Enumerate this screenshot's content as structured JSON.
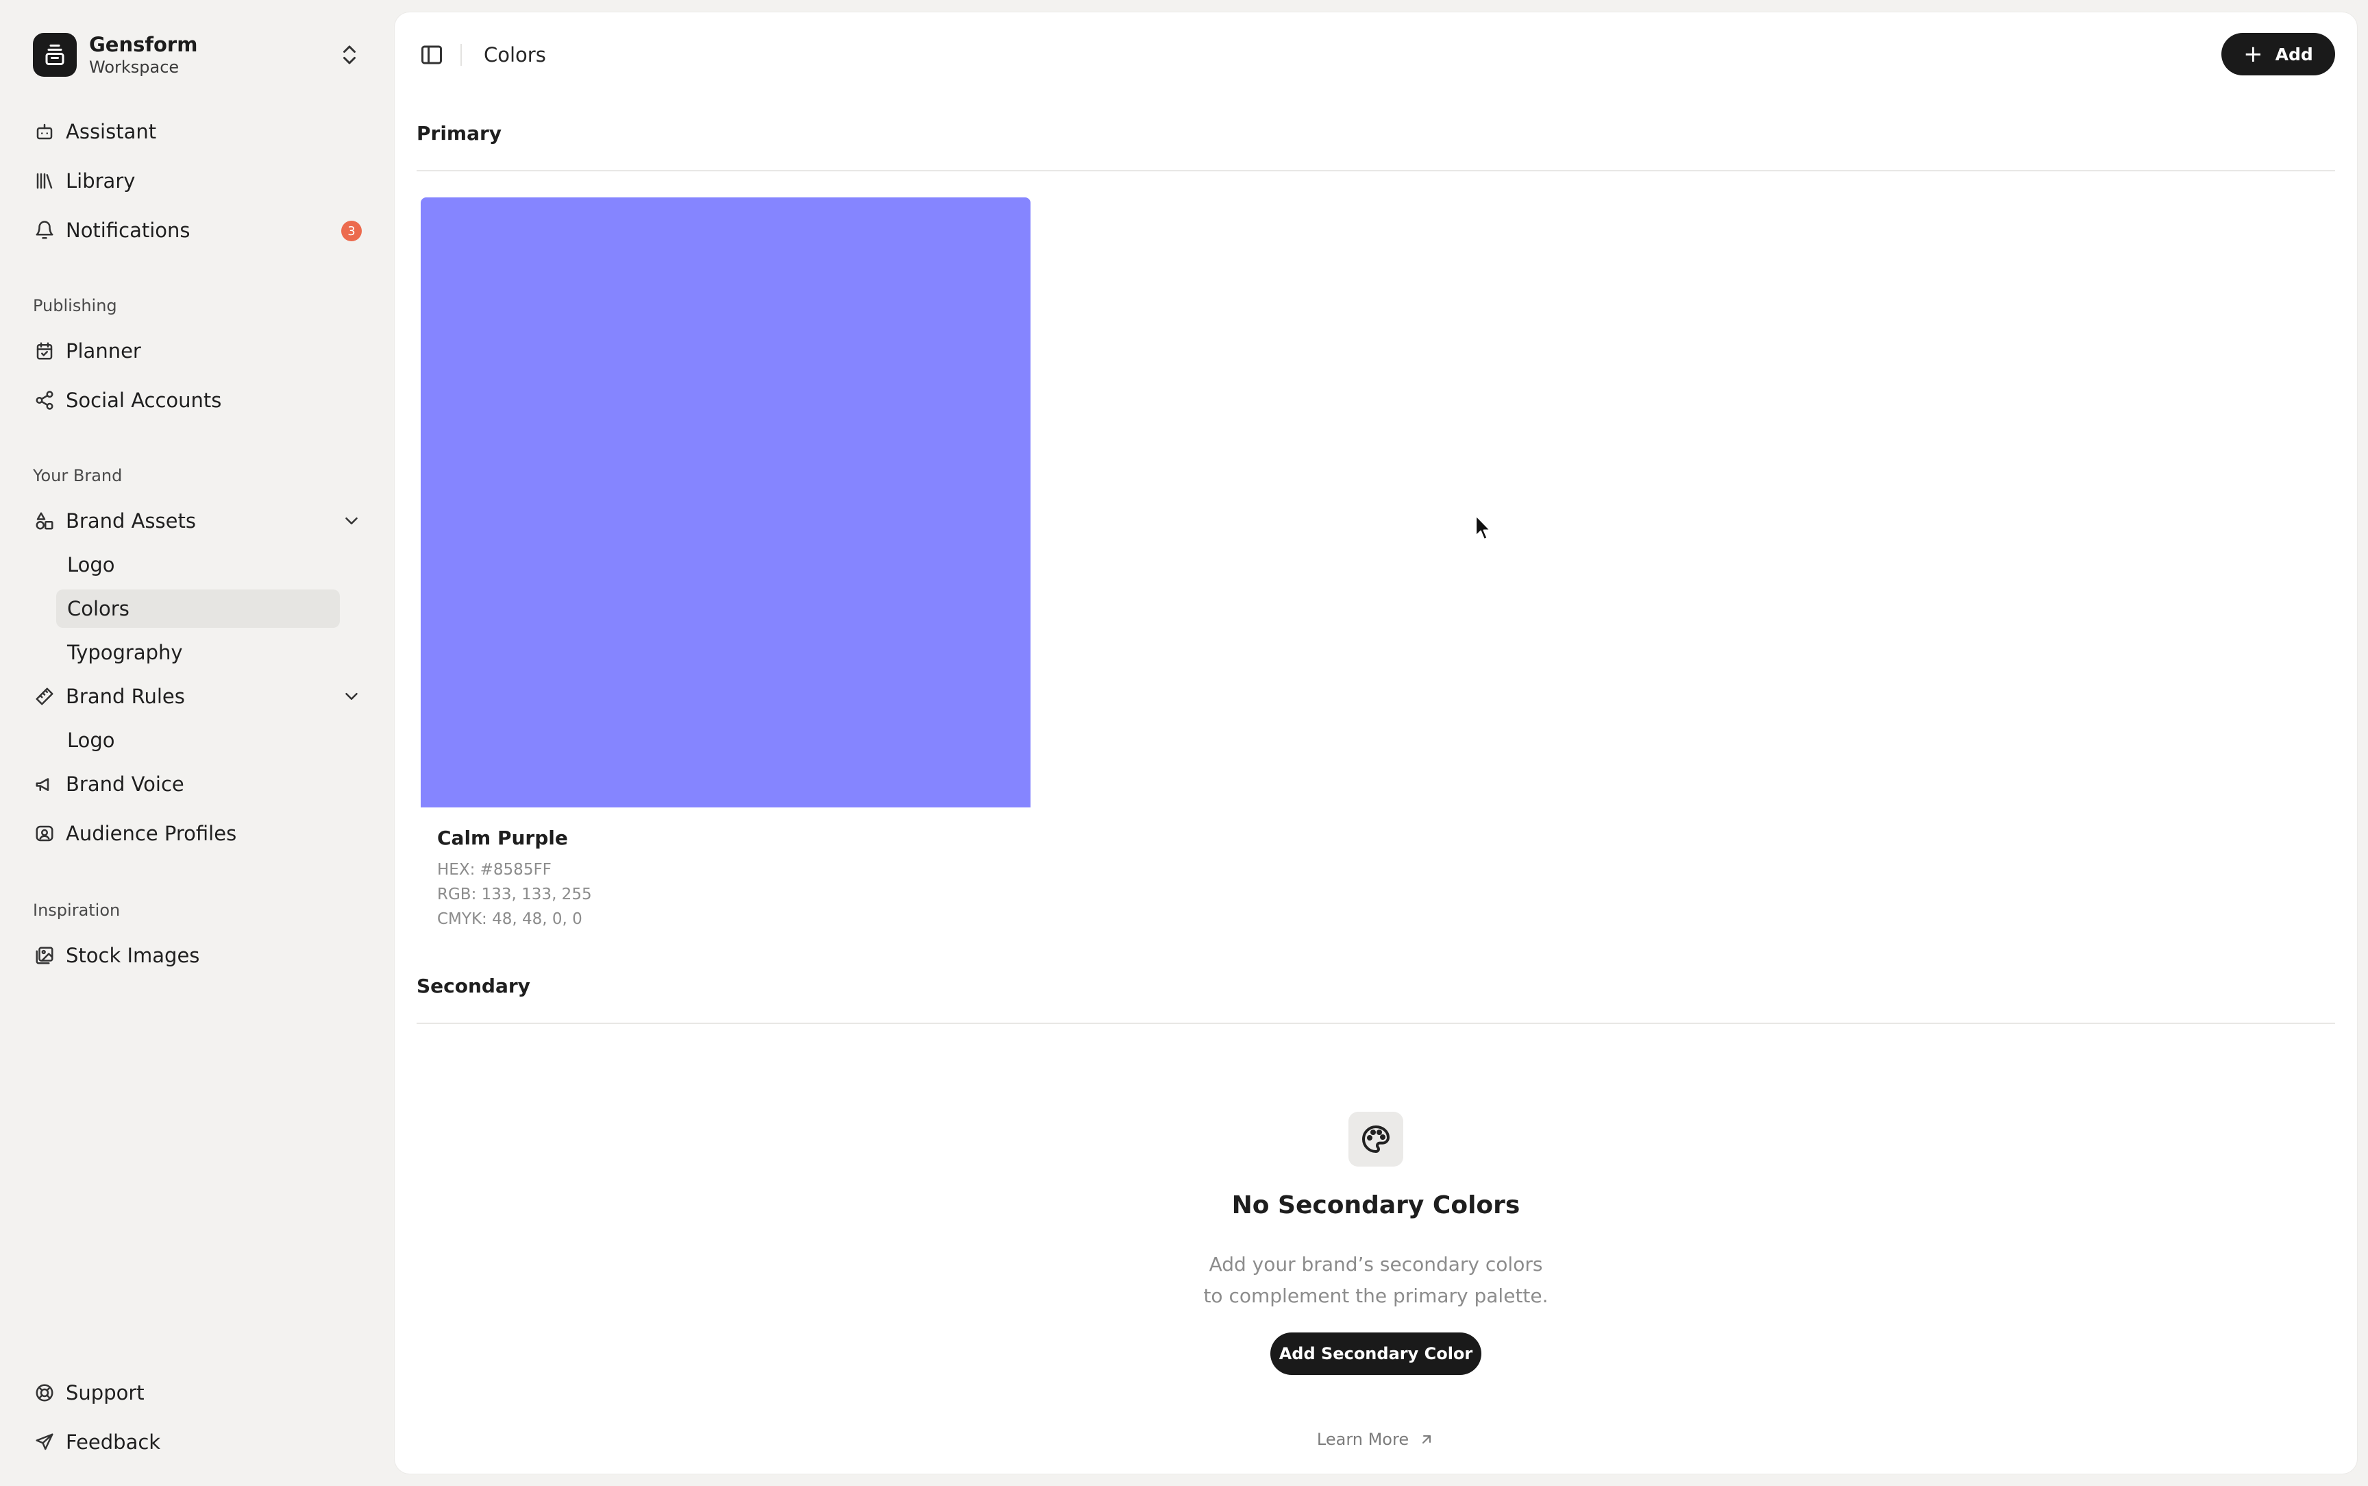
{
  "workspace": {
    "name": "Gensform",
    "subtitle": "Workspace"
  },
  "sidebar": {
    "nav": [
      {
        "label": "Assistant",
        "icon": "bot-icon"
      },
      {
        "label": "Library",
        "icon": "library-icon"
      },
      {
        "label": "Notifications",
        "icon": "bell-icon",
        "badge": "3"
      }
    ],
    "sections": {
      "publishing": "Publishing",
      "your_brand": "Your Brand",
      "inspiration": "Inspiration"
    },
    "publishing": [
      {
        "label": "Planner",
        "icon": "calendar-icon"
      },
      {
        "label": "Social Accounts",
        "icon": "share-icon"
      }
    ],
    "brand_assets": {
      "label": "Brand Assets",
      "children": [
        "Logo",
        "Colors",
        "Typography"
      ]
    },
    "brand_rules": {
      "label": "Brand Rules",
      "children": [
        "Logo"
      ]
    },
    "brand_voice": "Brand Voice",
    "audience_profiles": "Audience Profiles",
    "stock_images": "Stock Images",
    "support": "Support",
    "feedback": "Feedback"
  },
  "header": {
    "breadcrumb": "Colors",
    "add_label": "Add"
  },
  "primary": {
    "title": "Primary",
    "colors": [
      {
        "name": "Calm Purple",
        "swatch": "#8585FF",
        "hex": "HEX: #8585FF",
        "rgb": "RGB: 133, 133, 255",
        "cmyk": "CMYK: 48, 48, 0, 0"
      }
    ]
  },
  "secondary": {
    "title": "Secondary",
    "empty_title": "No Secondary Colors",
    "empty_line1": "Add your brand’s secondary colors",
    "empty_line2": "to complement the primary palette.",
    "button_label": "Add Secondary Color",
    "learn_more": "Learn More"
  },
  "colors": {
    "accent": "#1a1a1a",
    "badge": "#ec6b4e",
    "swatch": "#8585FF"
  }
}
